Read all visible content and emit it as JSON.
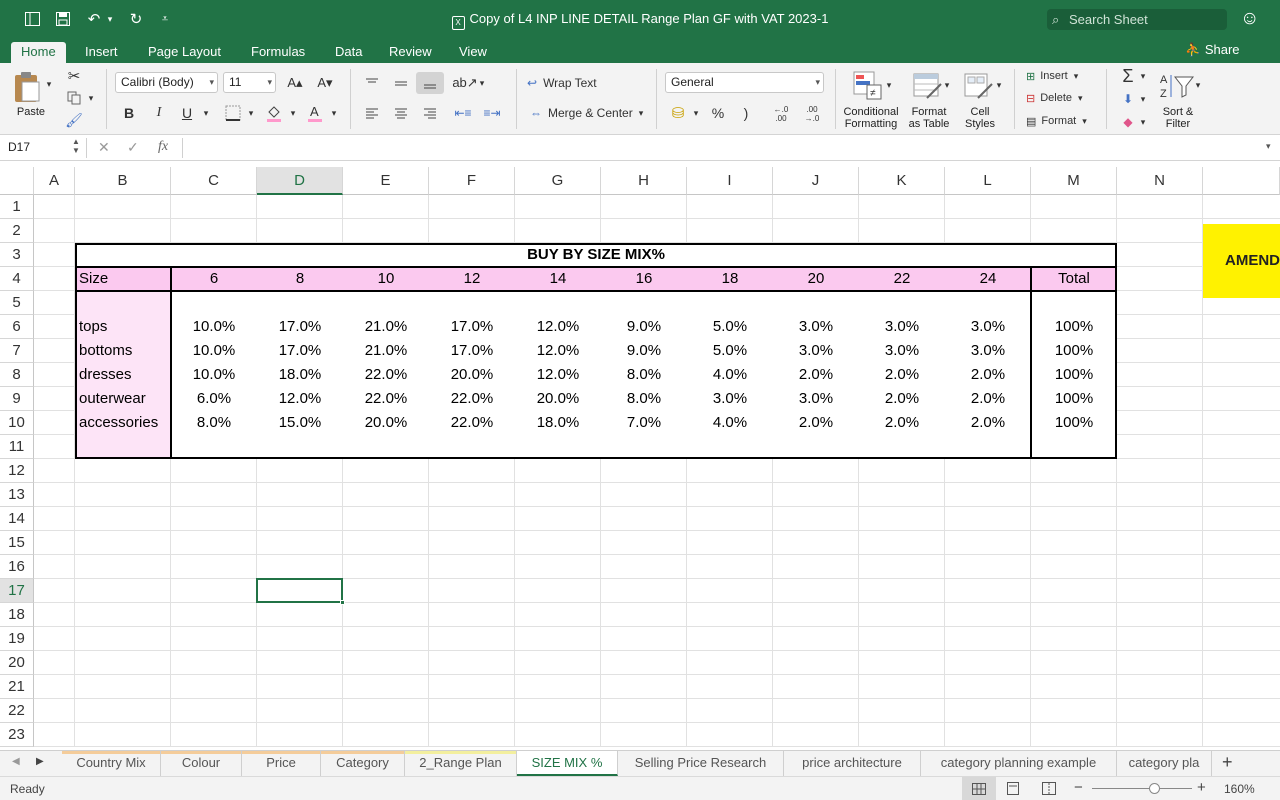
{
  "app": {
    "title": "Copy of L4 INP LINE DETAIL Range Plan GF with VAT 2023-1",
    "search_placeholder": "Search Sheet",
    "icons": [
      "sidebar-icon",
      "save-icon",
      "undo-icon",
      "redo-icon",
      "customize-icon",
      "search-icon",
      "smiley-icon",
      "share-icon"
    ]
  },
  "ribbon_tabs": [
    "Home",
    "Insert",
    "Page Layout",
    "Formulas",
    "Data",
    "Review",
    "View"
  ],
  "share_label": "Share",
  "ribbon": {
    "paste": "Paste",
    "font_name": "Calibri (Body)",
    "font_size": "11",
    "bold": "B",
    "italic": "I",
    "underline": "U",
    "wrap_text": "Wrap Text",
    "merge_center": "Merge & Center",
    "number_format": "General",
    "percent": "%",
    "comma": ")",
    "inc_decimal": "←.0\n.00",
    "dec_decimal": ".00\n→.0",
    "conditional_formatting": [
      "Conditional",
      "Formatting"
    ],
    "format_as_table": [
      "Format",
      "as Table"
    ],
    "cell_styles": [
      "Cell",
      "Styles"
    ],
    "insert": "Insert",
    "delete": "Delete",
    "format": "Format",
    "sort_filter": [
      "Sort &",
      "Filter"
    ]
  },
  "formula_bar": {
    "cell_ref": "D17",
    "fx": "fx",
    "content": ""
  },
  "grid": {
    "columns": [
      "A",
      "B",
      "C",
      "D",
      "E",
      "F",
      "G",
      "H",
      "I",
      "J",
      "K",
      "L",
      "M",
      "N"
    ],
    "selected_column": "D",
    "rows": [
      "1",
      "2",
      "3",
      "4",
      "5",
      "6",
      "7",
      "8",
      "9",
      "10",
      "11",
      "12",
      "13",
      "14",
      "15",
      "16",
      "17",
      "18",
      "19",
      "20",
      "21",
      "22",
      "23"
    ],
    "selected_row": "17",
    "selected_cell": "D17"
  },
  "table": {
    "title": "BUY BY SIZE MIX%",
    "size_label": "Size",
    "sizes": [
      "6",
      "8",
      "10",
      "12",
      "14",
      "16",
      "18",
      "20",
      "22",
      "24"
    ],
    "total_label": "Total",
    "rows": [
      {
        "category": "tops",
        "values": [
          "10.0%",
          "17.0%",
          "21.0%",
          "17.0%",
          "12.0%",
          "9.0%",
          "5.0%",
          "3.0%",
          "3.0%",
          "3.0%"
        ],
        "total": "100%"
      },
      {
        "category": "bottoms",
        "values": [
          "10.0%",
          "17.0%",
          "21.0%",
          "17.0%",
          "12.0%",
          "9.0%",
          "5.0%",
          "3.0%",
          "3.0%",
          "3.0%"
        ],
        "total": "100%"
      },
      {
        "category": "dresses",
        "values": [
          "10.0%",
          "18.0%",
          "22.0%",
          "20.0%",
          "12.0%",
          "8.0%",
          "4.0%",
          "2.0%",
          "2.0%",
          "2.0%"
        ],
        "total": "100%"
      },
      {
        "category": "outerwear",
        "values": [
          "6.0%",
          "12.0%",
          "22.0%",
          "22.0%",
          "20.0%",
          "8.0%",
          "3.0%",
          "3.0%",
          "2.0%",
          "2.0%"
        ],
        "total": "100%"
      },
      {
        "category": "accessories",
        "values": [
          "8.0%",
          "15.0%",
          "20.0%",
          "22.0%",
          "18.0%",
          "7.0%",
          "4.0%",
          "2.0%",
          "2.0%",
          "2.0%"
        ],
        "total": "100%"
      }
    ],
    "note": "AMEND"
  },
  "colors": {
    "excel_green": "#217346",
    "header_pink": "#fbc9ef",
    "category_pink": "#fde4f7",
    "note_yellow": "#fff200"
  },
  "sheet_tabs": [
    {
      "label": "Country Mix",
      "color": "#f4cc9a"
    },
    {
      "label": "Colour",
      "color": "#f4cc9a"
    },
    {
      "label": "Price",
      "color": "#f4cc9a"
    },
    {
      "label": "Category",
      "color": "#f4cc9a"
    },
    {
      "label": "2_Range Plan",
      "color": "#f3ef9e"
    },
    {
      "label": "SIZE MIX %",
      "color": "",
      "active": true
    },
    {
      "label": "Selling Price Research",
      "color": ""
    },
    {
      "label": "price architecture",
      "color": ""
    },
    {
      "label": "category planning example",
      "color": ""
    },
    {
      "label": "category pla",
      "color": ""
    }
  ],
  "status": {
    "ready": "Ready",
    "zoom": "160%",
    "zoom_level": 0.62
  }
}
